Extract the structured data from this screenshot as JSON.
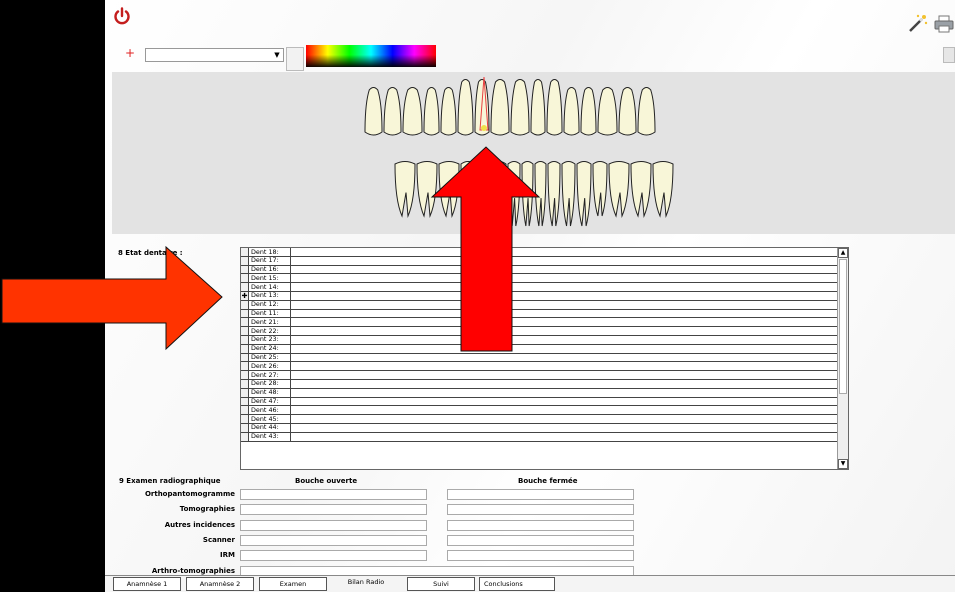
{
  "toolbar": {
    "power_icon": "power-icon",
    "wand_icon": "magic-wand-icon",
    "print_icon": "printer-icon",
    "plus_glyph": "+",
    "combo_value": "",
    "combo_arrow": "▼"
  },
  "dental": {
    "section_label": "8 Etat dentaire :",
    "teeth_rows": [
      {
        "label": "Dent 18:",
        "value": "",
        "marker": ""
      },
      {
        "label": "Dent 17:",
        "value": "",
        "marker": ""
      },
      {
        "label": "Dent 16:",
        "value": "",
        "marker": ""
      },
      {
        "label": "Dent 15:",
        "value": "",
        "marker": ""
      },
      {
        "label": "Dent 14:",
        "value": "",
        "marker": ""
      },
      {
        "label": "Dent 13:",
        "value": "",
        "marker": "✚"
      },
      {
        "label": "Dent 12:",
        "value": "",
        "marker": ""
      },
      {
        "label": "Dent 11:",
        "value": "",
        "marker": ""
      },
      {
        "label": "Dent 21:",
        "value": "",
        "marker": ""
      },
      {
        "label": "Dent 22:",
        "value": "",
        "marker": ""
      },
      {
        "label": "Dent 23:",
        "value": "",
        "marker": ""
      },
      {
        "label": "Dent 24:",
        "value": "",
        "marker": ""
      },
      {
        "label": "Dent 25:",
        "value": "",
        "marker": ""
      },
      {
        "label": "Dent 26:",
        "value": "",
        "marker": ""
      },
      {
        "label": "Dent 27:",
        "value": "",
        "marker": ""
      },
      {
        "label": "Dent 28:",
        "value": "",
        "marker": ""
      },
      {
        "label": "Dent 48:",
        "value": "",
        "marker": ""
      },
      {
        "label": "Dent 47:",
        "value": "",
        "marker": ""
      },
      {
        "label": "Dent 46:",
        "value": "",
        "marker": ""
      },
      {
        "label": "Dent 45:",
        "value": "",
        "marker": ""
      },
      {
        "label": "Dent 44:",
        "value": "",
        "marker": ""
      },
      {
        "label": "Dent 43:",
        "value": "",
        "marker": ""
      }
    ],
    "scroll_up": "▲",
    "scroll_down": "▼"
  },
  "exam": {
    "section_label": "9 Examen radiographique",
    "col_open": "Bouche ouverte",
    "col_closed": "Bouche fermée",
    "rows": [
      {
        "label": "Orthopantomogramme",
        "open": "",
        "closed": ""
      },
      {
        "label": "Tomographies",
        "open": "",
        "closed": ""
      },
      {
        "label": "Autres incidences",
        "open": "",
        "closed": ""
      },
      {
        "label": "Scanner",
        "open": "",
        "closed": ""
      },
      {
        "label": "IRM",
        "open": "",
        "closed": ""
      },
      {
        "label": "Arthro-tomographies",
        "open": "",
        "closed": ""
      }
    ]
  },
  "tabs": [
    {
      "label": "Anamnèse 1"
    },
    {
      "label": "Anamnèse 2"
    },
    {
      "label": "Examen"
    },
    {
      "label": "Bilan Radio"
    },
    {
      "label": "Suivi"
    },
    {
      "label": "Conclusions"
    }
  ],
  "colors": {
    "left_arrow": "#ff3300",
    "up_arrow": "#ff0000",
    "power": "#c41e1e",
    "tooth_fill": "#f8f6d8",
    "tooth_highlight": "#f0e04a"
  }
}
